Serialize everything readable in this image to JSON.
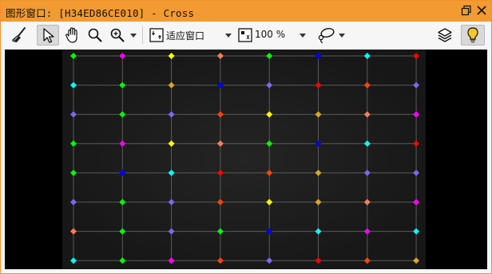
{
  "window": {
    "title": "图形窗口: [H34ED86CE010] - Cross"
  },
  "toolbar": {
    "fit_label": "适应窗口",
    "zoom_label": "100 %"
  },
  "icons": [
    "broom-icon",
    "pointer-icon",
    "hand-icon",
    "magnifier-icon",
    "zoom-in-icon",
    "fit-window-icon",
    "zoom-percent-icon",
    "lasso-icon",
    "layers-icon",
    "lightbulb-icon",
    "restore-icon",
    "close-icon"
  ],
  "grid": {
    "rows": [
      [
        "#00ff00",
        "#ff00ff",
        "#ffff00",
        "#ff7f50",
        "#00ff00",
        "#0000ff",
        "#00ffff",
        "#ff0000"
      ],
      [
        "#00ffff",
        "#00ff00",
        "#daa520",
        "#0000ff",
        "#7b68ee",
        "#ff0000",
        "#ff4500",
        "#7b68ee"
      ],
      [
        "#7b68ee",
        "#00ff00",
        "#7b68ee",
        "#ff4500",
        "#ffff00",
        "#daa520",
        "#ff7f50",
        "#ff00ff"
      ],
      [
        "#00ff00",
        "#ff00ff",
        "#ffff00",
        "#ff7f50",
        "#00ff00",
        "#0000ff",
        "#00ffff",
        "#ff0000"
      ],
      [
        "#00ff00",
        "#0000ff",
        "#00ffff",
        "#ff0000",
        "#ff4500",
        "#daa520",
        "#7b68ee",
        "#7b68ee"
      ],
      [
        "#7b68ee",
        "#00ff00",
        "#7b68ee",
        "#ff4500",
        "#ffff00",
        "#daa520",
        "#ff7f50",
        "#ff00ff"
      ],
      [
        "#ff7f50",
        "#00ff00",
        "#7b68ee",
        "#00ff00",
        "#0000ff",
        "#00ffff",
        "#ff00ff",
        "#00ffff"
      ],
      [
        "#00ffff",
        "#00ff00",
        "#ff00ff",
        "#ff4500",
        "#7b68ee",
        "#ff0000",
        "#ff4500",
        "#daa520"
      ]
    ],
    "line_color": "#5a5a5a"
  }
}
